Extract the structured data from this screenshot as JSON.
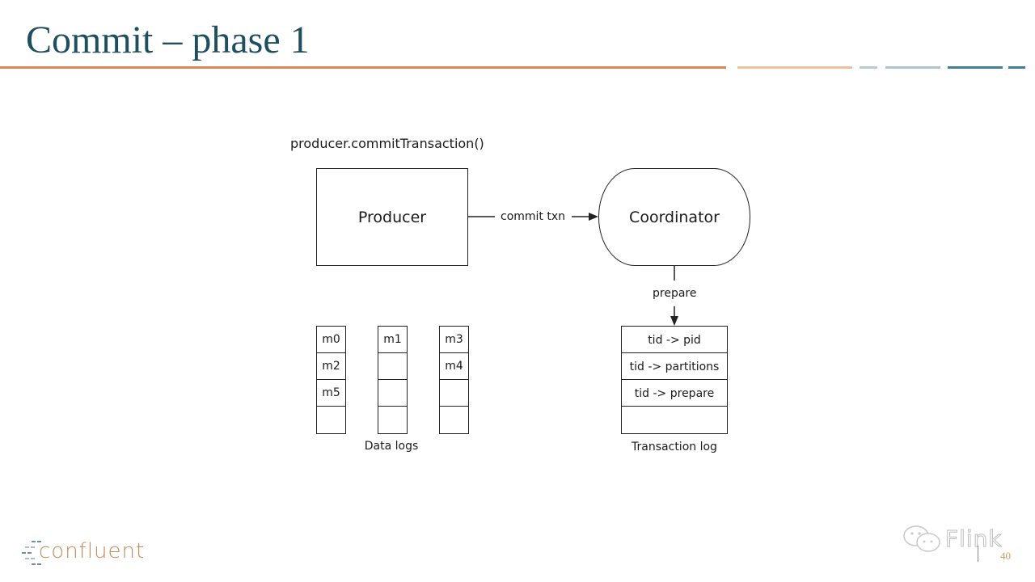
{
  "slide": {
    "title": "Commit – phase 1",
    "page_number": "40",
    "accent_colors": {
      "title": "#1f4e5f",
      "rule_orange": "#d9875a",
      "rule_light_orange": "#eec29f",
      "rule_light_blue": "#adc4d6",
      "rule_teal": "#3f7d98"
    }
  },
  "diagram": {
    "call_label": "producer.commitTransaction()",
    "producer": {
      "label": "Producer"
    },
    "coordinator": {
      "label": "Coordinator"
    },
    "edge_commit": {
      "label": "commit txn"
    },
    "edge_prepare": {
      "label": "prepare"
    },
    "data_logs": {
      "caption": "Data logs",
      "partitions": [
        {
          "cells": [
            "m0",
            "m2",
            "m5",
            ""
          ]
        },
        {
          "cells": [
            "m1",
            "",
            "",
            ""
          ]
        },
        {
          "cells": [
            "m3",
            "m4",
            "",
            ""
          ]
        }
      ]
    },
    "transaction_log": {
      "caption": "Transaction log",
      "cells": [
        "tid -> pid",
        "tid -> partitions",
        "tid -> prepare",
        ""
      ]
    }
  },
  "footer": {
    "logo_text": "confluent",
    "watermark_text": "Flink"
  }
}
